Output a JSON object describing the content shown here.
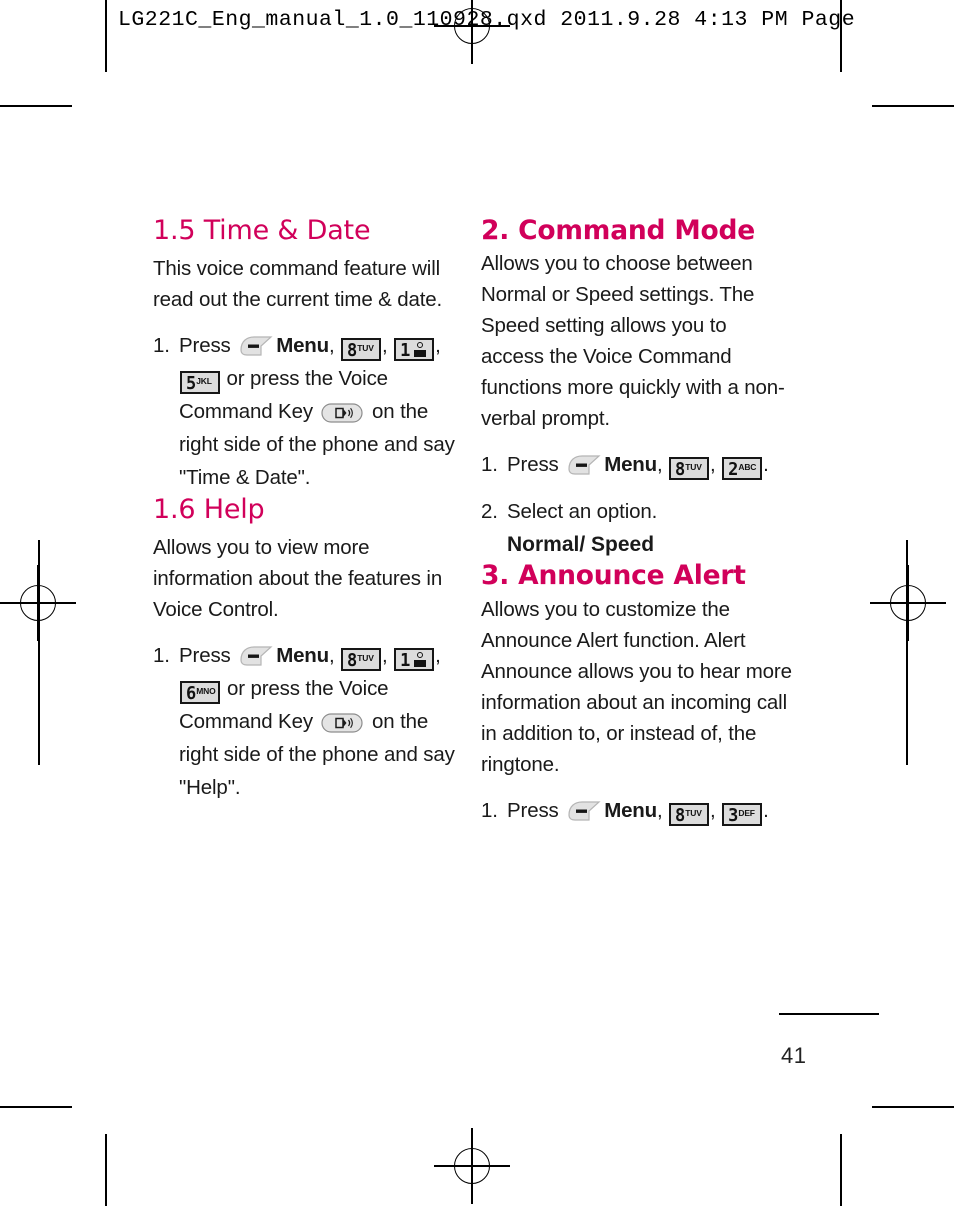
{
  "print_header": {
    "text": "LG221C_Eng_manual_1.0_110928.qxd  2011.9.28  4:13 PM  Page"
  },
  "theme": {
    "heading_color": "#D1005A",
    "text_color": "#1a1a1a",
    "keycap_fill": "#dcdcdc",
    "keycap_border": "#161616"
  },
  "left_column": {
    "sections": [
      {
        "heading": "1.5 Time & Date",
        "heading_style": "light",
        "paragraph": "This voice command feature will read out the current time & date.",
        "steps": [
          {
            "number": "1.",
            "parts": [
              {
                "type": "text",
                "value": "Press "
              },
              {
                "type": "softkey",
                "name": "menu-softkey"
              },
              {
                "type": "bold",
                "value": "Menu"
              },
              {
                "type": "text",
                "value": ", "
              },
              {
                "type": "key",
                "digit": "8",
                "letters": "TUV"
              },
              {
                "type": "text",
                "value": ", "
              },
              {
                "type": "key",
                "digit": "1",
                "letters": "voicemail"
              },
              {
                "type": "text",
                "value": ", "
              },
              {
                "type": "key",
                "digit": "5",
                "letters": "JKL"
              },
              {
                "type": "text",
                "value": " or press the Voice Command Key "
              },
              {
                "type": "vckey",
                "name": "voice-command-key"
              },
              {
                "type": "text",
                "value": " on the right side of the phone and say \"Time & Date\"."
              }
            ]
          }
        ]
      },
      {
        "heading": "1.6 Help",
        "heading_style": "light",
        "paragraph": "Allows you to view more information about the features in Voice Control.",
        "steps": [
          {
            "number": "1.",
            "parts": [
              {
                "type": "text",
                "value": "Press "
              },
              {
                "type": "softkey",
                "name": "menu-softkey"
              },
              {
                "type": "bold",
                "value": "Menu"
              },
              {
                "type": "text",
                "value": ", "
              },
              {
                "type": "key",
                "digit": "8",
                "letters": "TUV"
              },
              {
                "type": "text",
                "value": ", "
              },
              {
                "type": "key",
                "digit": "1",
                "letters": "voicemail"
              },
              {
                "type": "text",
                "value": ", "
              },
              {
                "type": "key",
                "digit": "6",
                "letters": "MNO"
              },
              {
                "type": "text",
                "value": " or press the Voice Command Key "
              },
              {
                "type": "vckey",
                "name": "voice-command-key"
              },
              {
                "type": "text",
                "value": " on the right side of the phone and say \"Help\"."
              }
            ]
          }
        ]
      }
    ]
  },
  "right_column": {
    "sections": [
      {
        "heading": "2. Command Mode",
        "heading_style": "bold",
        "paragraph": "Allows you to choose between Normal or Speed settings. The Speed setting allows you to access the Voice Command functions more quickly with a non-verbal prompt.",
        "steps": [
          {
            "number": "1.",
            "parts": [
              {
                "type": "text",
                "value": "Press "
              },
              {
                "type": "softkey",
                "name": "menu-softkey"
              },
              {
                "type": "bold",
                "value": "Menu"
              },
              {
                "type": "text",
                "value": ", "
              },
              {
                "type": "key",
                "digit": "8",
                "letters": "TUV"
              },
              {
                "type": "text",
                "value": ", "
              },
              {
                "type": "key",
                "digit": "2",
                "letters": "ABC"
              },
              {
                "type": "text",
                "value": "."
              }
            ]
          },
          {
            "number": "2.",
            "parts": [
              {
                "type": "text",
                "value": "Select an option."
              }
            ],
            "option_line": "Normal/ Speed"
          }
        ]
      },
      {
        "heading": "3. Announce Alert",
        "heading_style": "bold",
        "paragraph": "Allows you to customize the Announce Alert function. Alert Announce allows you to hear more information about an incoming call in addition to, or instead of, the ringtone.",
        "steps": [
          {
            "number": "1.",
            "parts": [
              {
                "type": "text",
                "value": "Press "
              },
              {
                "type": "softkey",
                "name": "menu-softkey"
              },
              {
                "type": "bold",
                "value": "Menu"
              },
              {
                "type": "text",
                "value": ", "
              },
              {
                "type": "key",
                "digit": "8",
                "letters": "TUV"
              },
              {
                "type": "text",
                "value": ", "
              },
              {
                "type": "key",
                "digit": "3",
                "letters": "DEF"
              },
              {
                "type": "text",
                "value": "."
              }
            ]
          }
        ]
      }
    ]
  },
  "footer": {
    "page_number": "41"
  }
}
